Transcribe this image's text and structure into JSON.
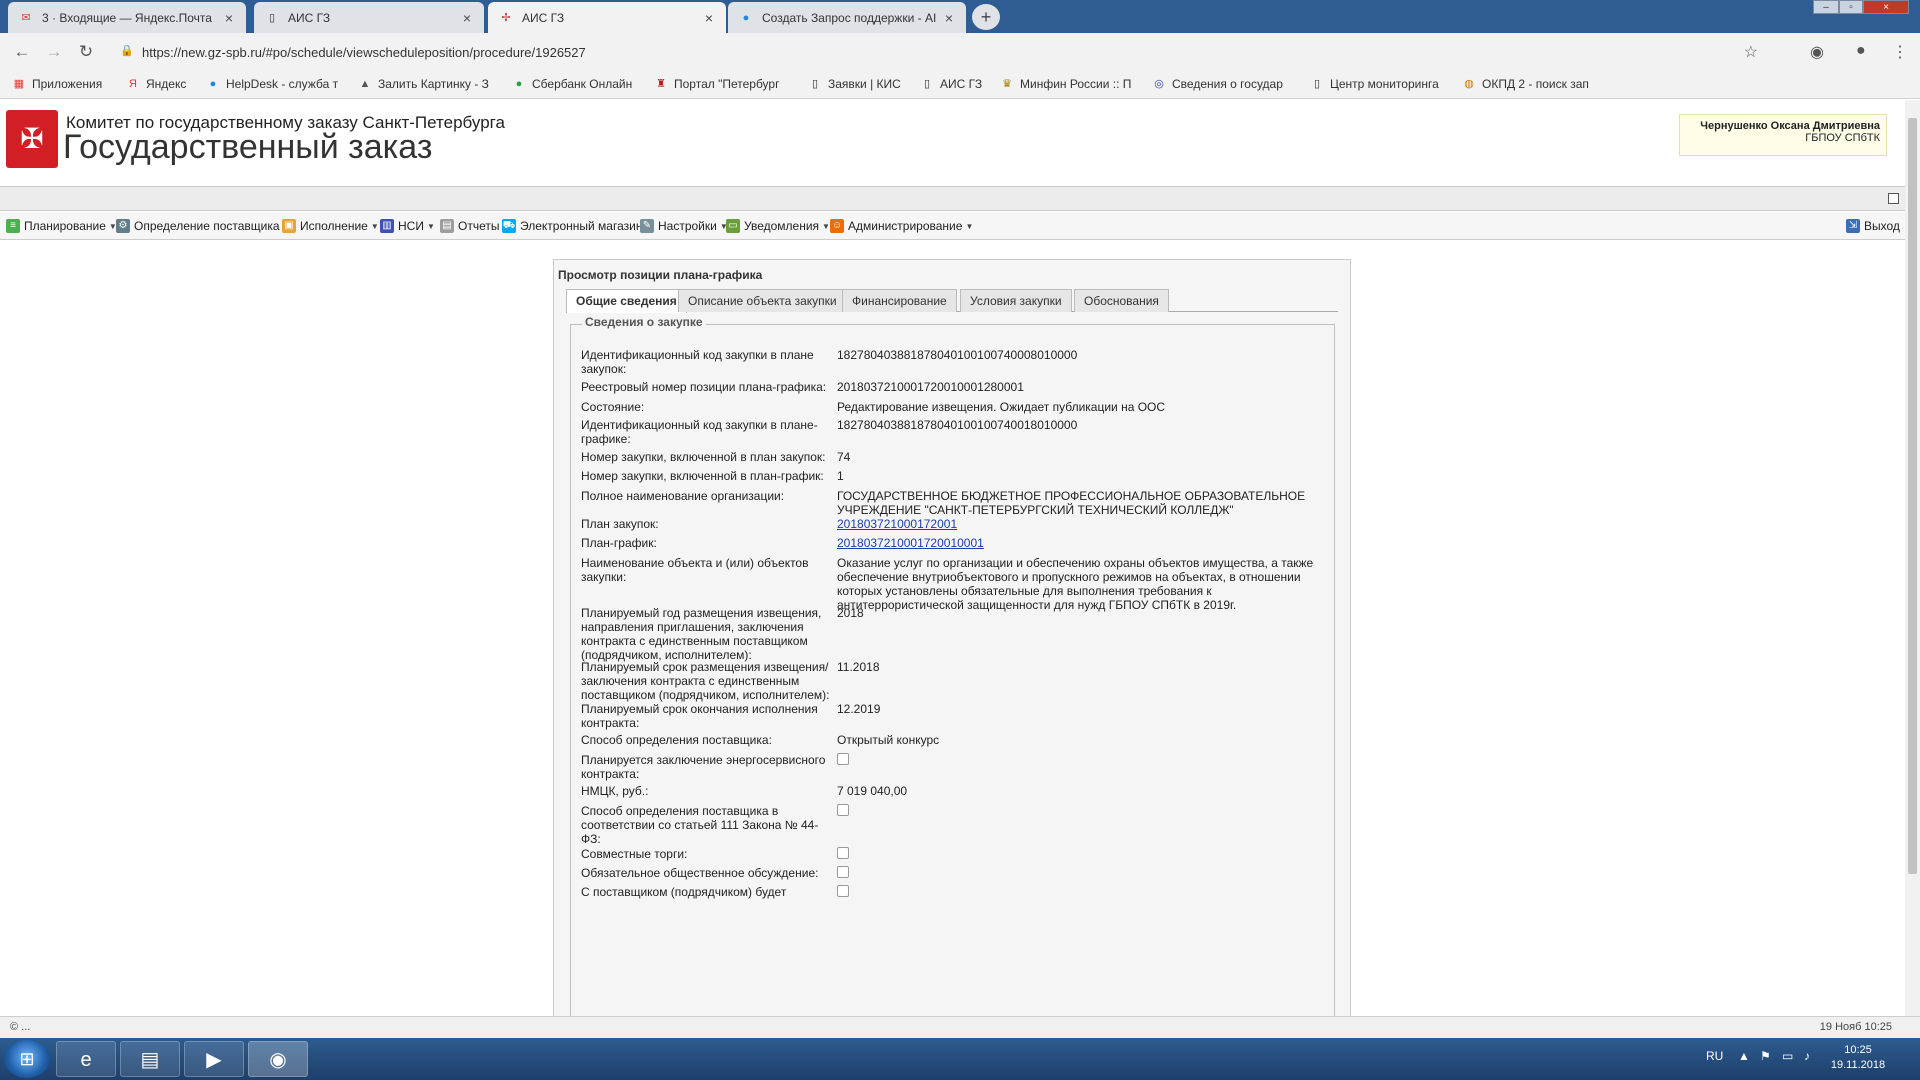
{
  "browser": {
    "tabs": [
      {
        "title": "3 · Входящие — Яндекс.Почта",
        "icon": "mail-icon"
      },
      {
        "title": "АИС ГЗ",
        "icon": "page-icon"
      },
      {
        "title": "АИС ГЗ",
        "icon": "gz-icon"
      },
      {
        "title": "Создать Запрос поддержки - AI",
        "icon": "globe-icon"
      }
    ],
    "url": "https://new.gz-spb.ru/#po/schedule/viewscheduleposition/procedure/1926527",
    "bookmarks": [
      "Приложения",
      "Яндекс",
      "HelpDesk - служба т",
      "Залить Картинку - З",
      "Сбербанк Онлайн",
      "Портал \"Петербург",
      "Заявки | КИС",
      "АИС ГЗ",
      "Минфин России :: П",
      "Сведения о государ",
      "Центр мониторинга",
      "ОКПД 2 - поиск зап"
    ]
  },
  "app": {
    "org": "Комитет по государственному заказу Санкт-Петербурга",
    "title": "Государственный заказ",
    "user_name": "Чернушенко Оксана Дмитриевна",
    "user_org": "ГБПОУ СПбТК",
    "menu": [
      {
        "label": "Планирование",
        "dropdown": true
      },
      {
        "label": "Определение поставщика",
        "dropdown": true
      },
      {
        "label": "Исполнение",
        "dropdown": true
      },
      {
        "label": "НСИ",
        "dropdown": true
      },
      {
        "label": "Отчеты",
        "dropdown": false
      },
      {
        "label": "Электронный магазин",
        "dropdown": false
      },
      {
        "label": "Настройки",
        "dropdown": true
      },
      {
        "label": "Уведомления",
        "dropdown": true
      },
      {
        "label": "Администрирование",
        "dropdown": true
      }
    ],
    "logout": "Выход"
  },
  "panel": {
    "title": "Просмотр позиции плана-графика",
    "tabs": [
      "Общие сведения",
      "Описание объекта закупки",
      "Финансирование",
      "Условия закупки",
      "Обоснования"
    ],
    "legend": "Сведения о закупке",
    "fields": [
      {
        "label": "Идентификационный код закупки в плане закупок:",
        "value": "182780403881878040100100740008010000"
      },
      {
        "label": "Реестровый номер позиции плана-графика:",
        "value": "2018037210001720010001280001"
      },
      {
        "label": "Состояние:",
        "value": "Редактирование извещения. Ожидает публикации на ООС"
      },
      {
        "label": "Идентификационный код закупки в плане-графике:",
        "value": "182780403881878040100100740018010000"
      },
      {
        "label": "Номер закупки, включенной в план закупок:",
        "value": "74"
      },
      {
        "label": "Номер закупки, включенной в план-график:",
        "value": "1"
      },
      {
        "label": "Полное наименование организации:",
        "value": "ГОСУДАРСТВЕННОЕ БЮДЖЕТНОЕ ПРОФЕССИОНАЛЬНОЕ ОБРАЗОВАТЕЛЬНОЕ УЧРЕЖДЕНИЕ \"САНКТ-ПЕТЕРБУРГСКИЙ ТЕХНИЧЕСКИЙ КОЛЛЕДЖ\""
      },
      {
        "label": "План закупок:",
        "value": "201803721000172001",
        "link": true
      },
      {
        "label": "План-график:",
        "value": "2018037210001720010001",
        "link": true
      },
      {
        "label": "Наименование объекта и (или) объектов закупки:",
        "value": "Оказание услуг по организации и обеспечению охраны объектов имущества, а также обеспечение внутриобъектового и пропускного режимов на объектах, в отношении которых установлены обязательные для выполнения требования к антитеррористической защищенности для нужд ГБПОУ СПбТК в 2019г."
      },
      {
        "label": "Планируемый год размещения извещения, направления приглашения, заключения контракта с единственным поставщиком (подрядчиком, исполнителем):",
        "value": "2018"
      },
      {
        "label": "Планируемый срок размещения извещения/ заключения контракта с единственным поставщиком (подрядчиком, исполнителем):",
        "value": "11.2018"
      },
      {
        "label": "Планируемый срок окончания исполнения контракта:",
        "value": "12.2019"
      },
      {
        "label": "Способ определения поставщика:",
        "value": "Открытый конкурс"
      },
      {
        "label": "Планируется заключение энергосервисного контракта:",
        "checkbox": true
      },
      {
        "label": "НМЦК, руб.:",
        "value": "7 019 040,00"
      },
      {
        "label": "Способ определения поставщика в соответствии со статьей 111 Закона № 44-ФЗ:",
        "checkbox": true
      },
      {
        "label": "Совместные торги:",
        "checkbox": true
      },
      {
        "label": "Обязательное общественное обсуждение:",
        "checkbox": true
      },
      {
        "label": "С поставщиком (подрядчиком) будет",
        "checkbox": true
      }
    ]
  },
  "status": {
    "left": "© ...",
    "right": "19 Нояб 10:25"
  },
  "taskbar": {
    "lang": "RU",
    "time": "10:25",
    "date": "19.11.2018"
  }
}
